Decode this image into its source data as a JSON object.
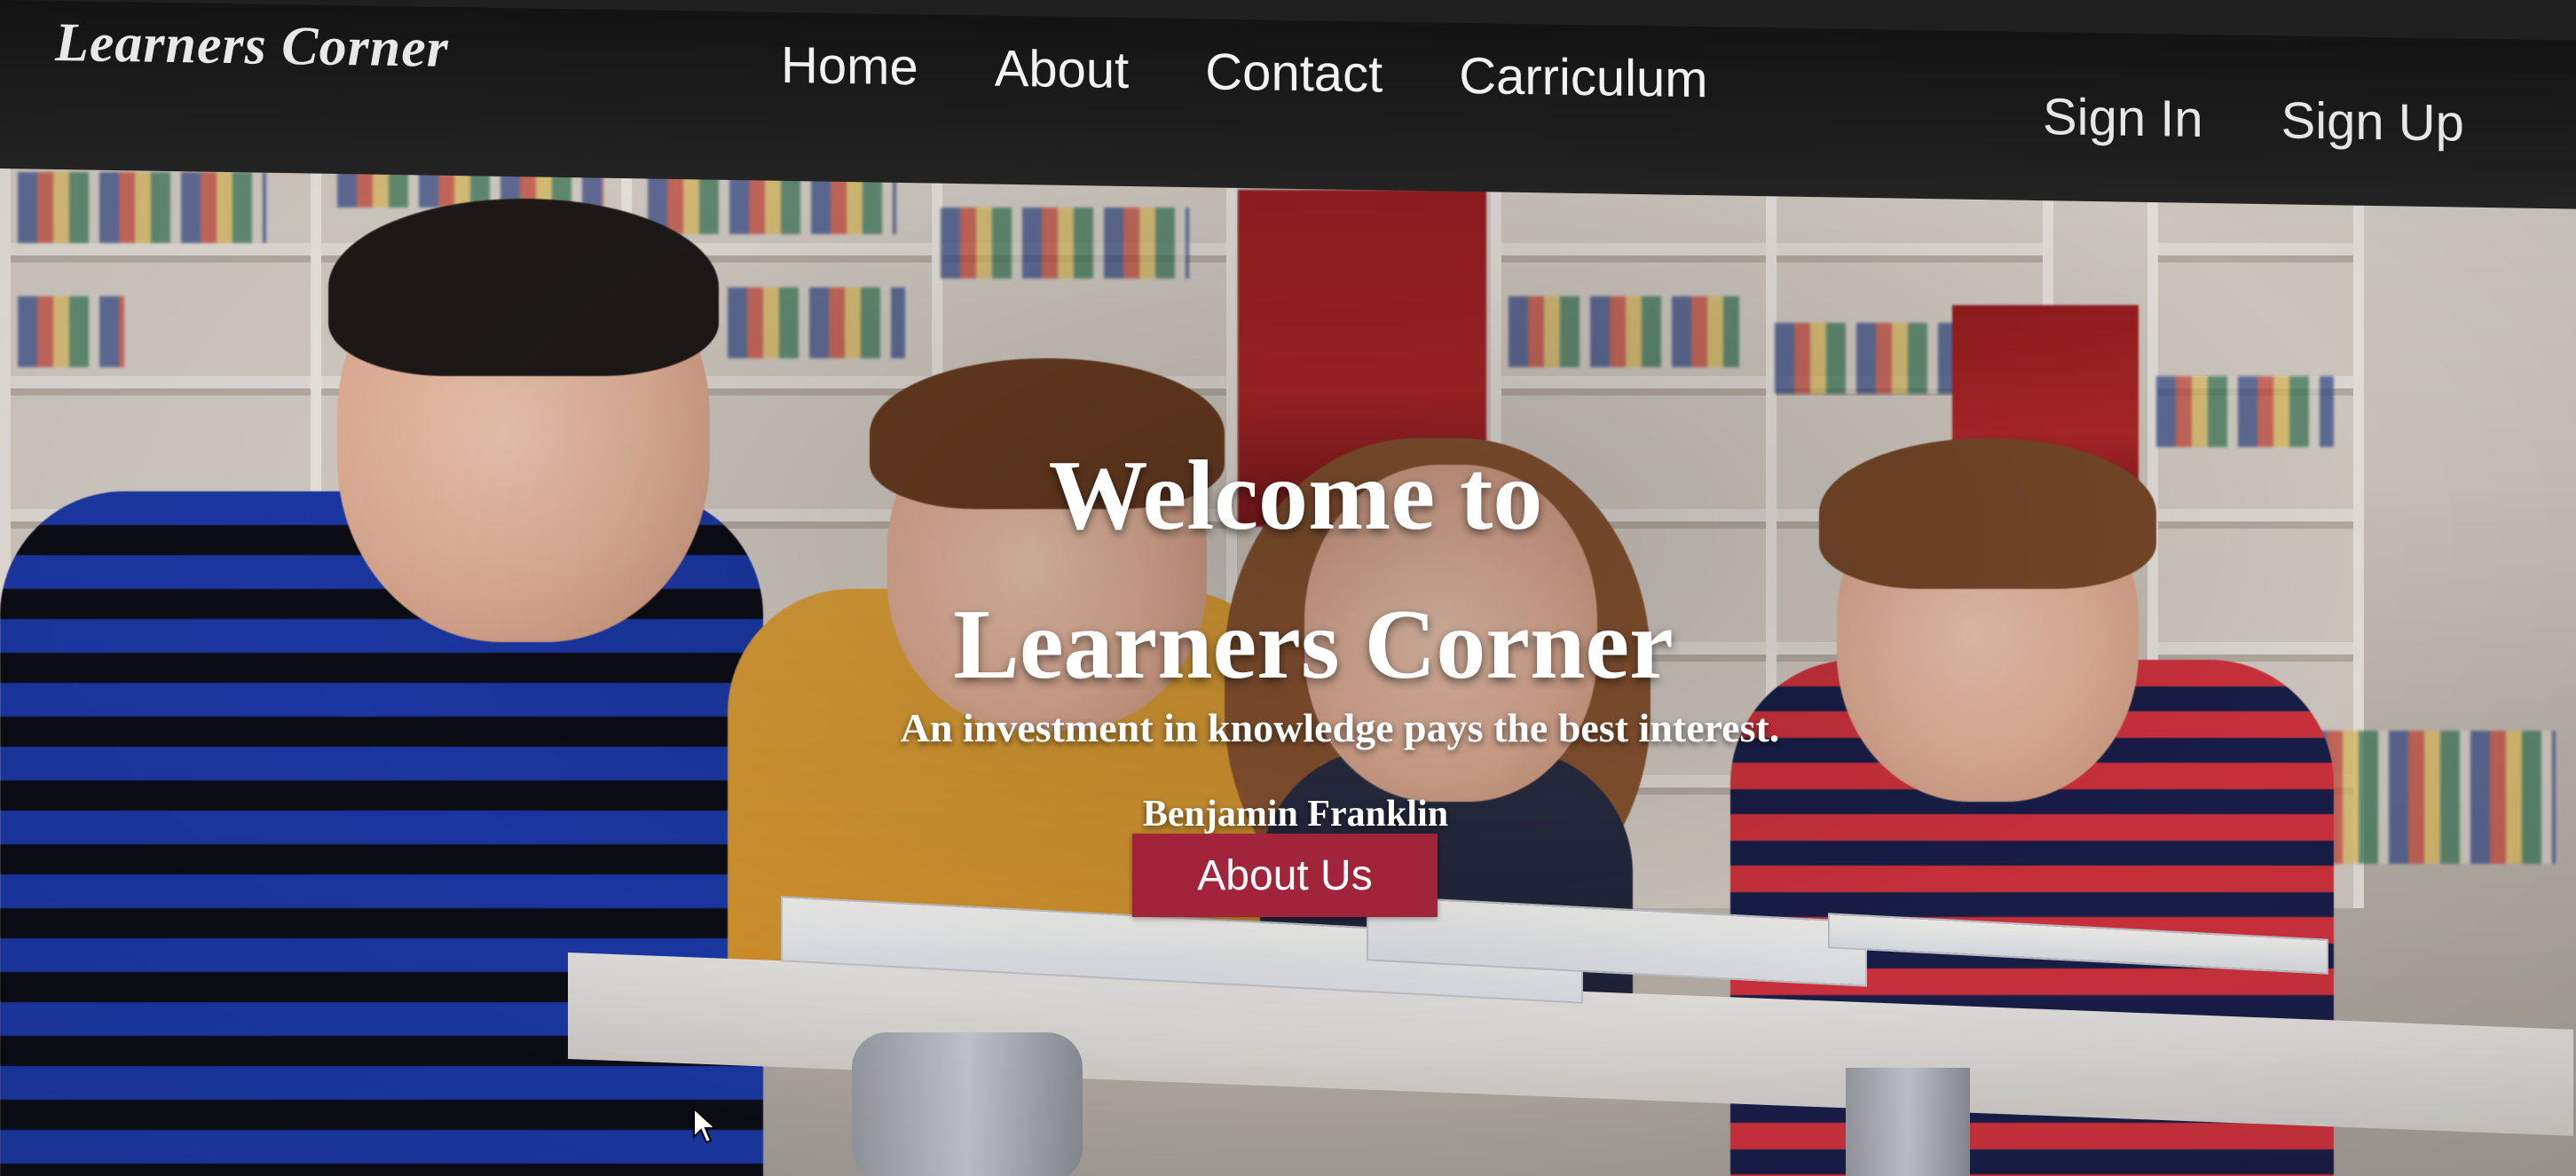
{
  "brand": {
    "name": "Learners Corner"
  },
  "nav": {
    "items": [
      {
        "label": "Home"
      },
      {
        "label": "About"
      },
      {
        "label": "Contact"
      },
      {
        "label": "Carriculum"
      }
    ]
  },
  "auth": {
    "sign_in": "Sign In",
    "sign_up": "Sign Up"
  },
  "hero": {
    "title_line1": "Welcome to",
    "title_line2": "Learners Corner",
    "quote": "An investment in knowledge pays the best interest.",
    "author": "Benjamin Franklin",
    "cta_label": "About Us",
    "image_icon": "hero-photo-children-reading"
  },
  "colors": {
    "nav_background": "#1a1a1a",
    "nav_text": "#f2f2f2",
    "cta_background": "#a1243b",
    "hero_text": "#ffffff"
  },
  "icons": {
    "cursor": "mouse-pointer-icon"
  }
}
